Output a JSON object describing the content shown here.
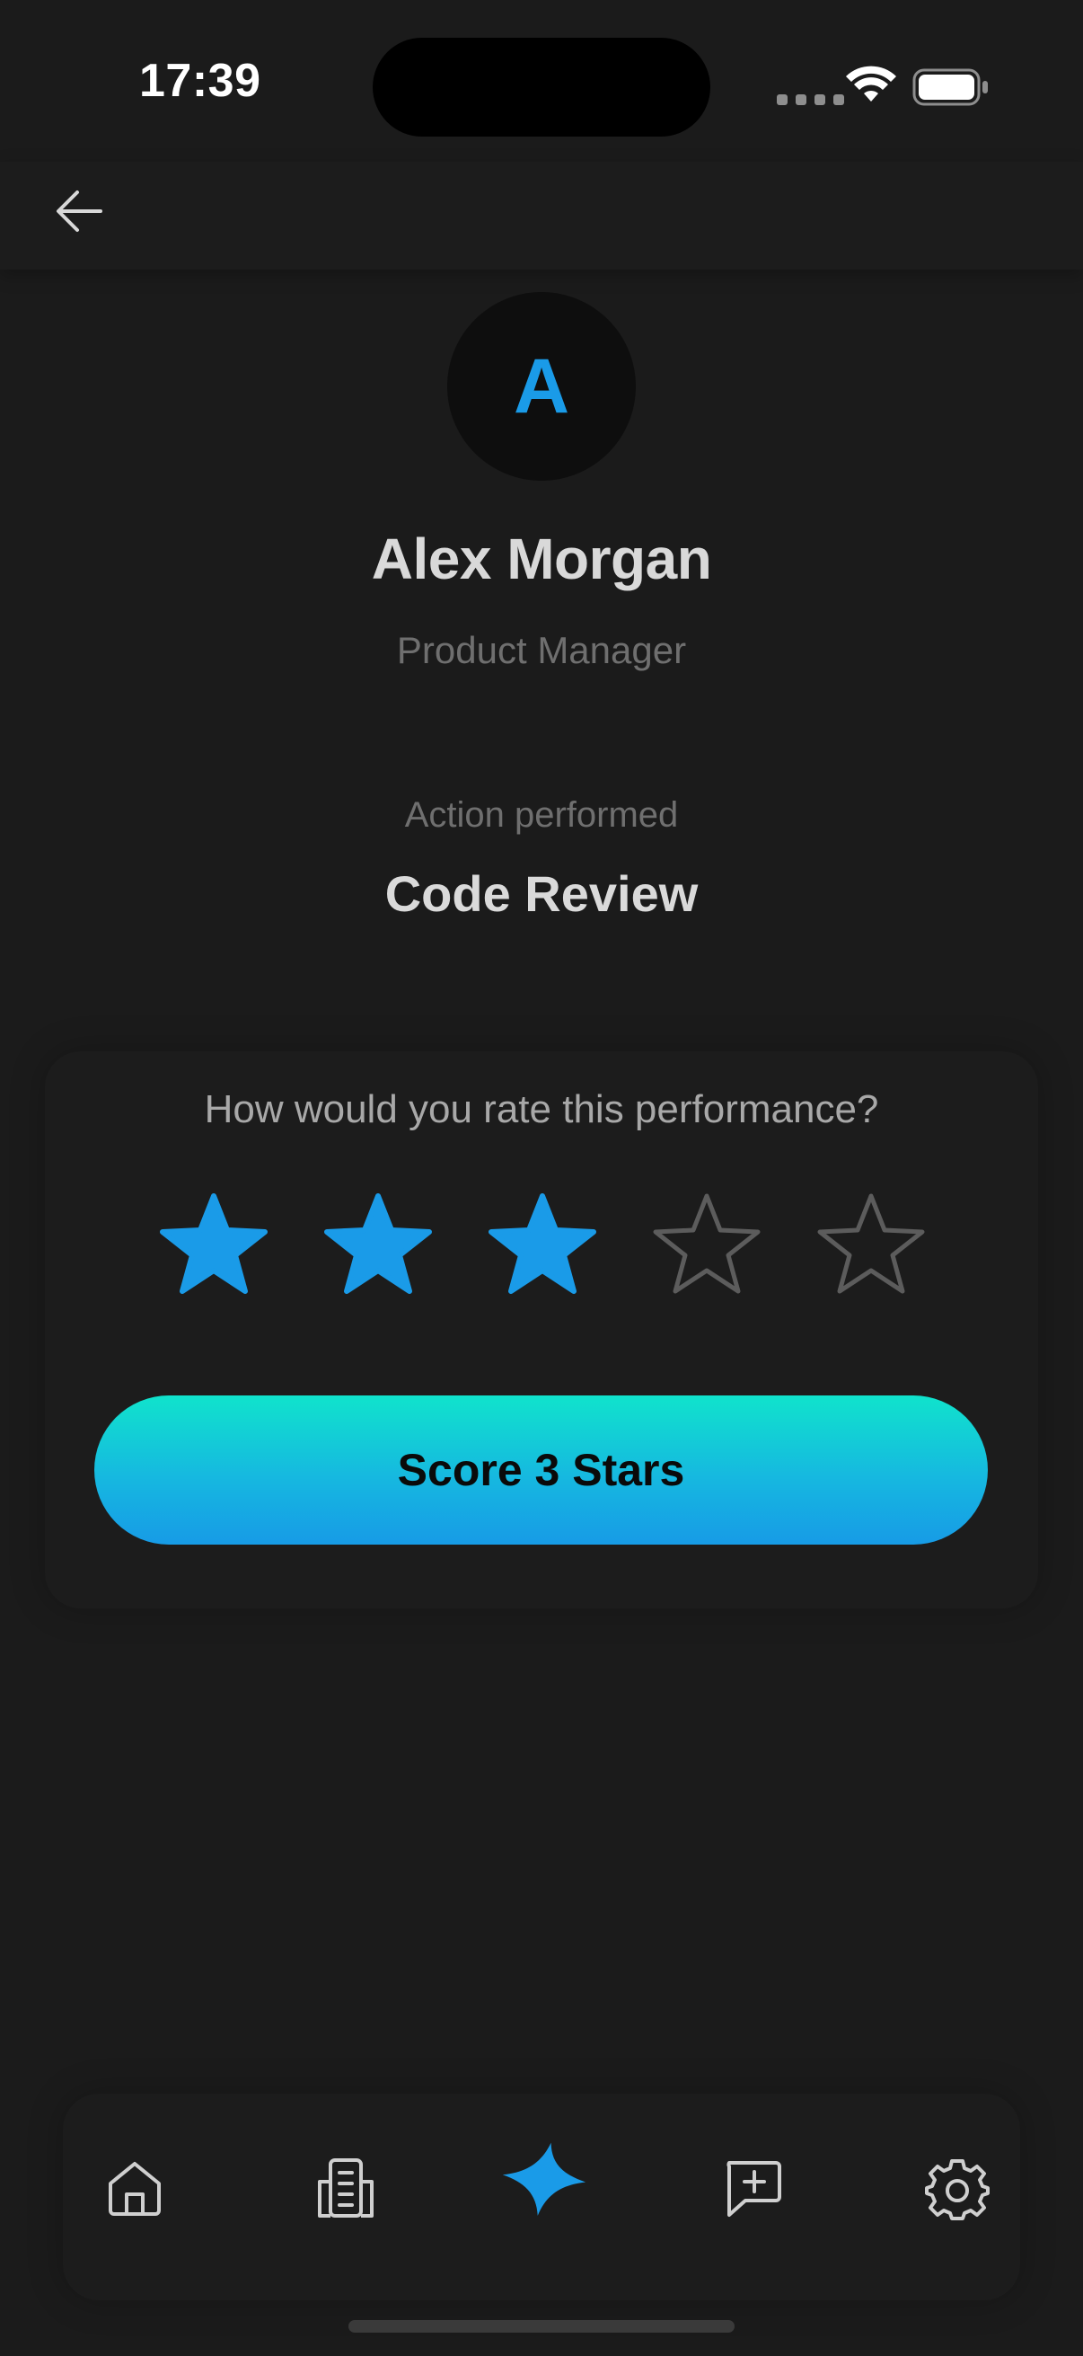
{
  "status_bar": {
    "time": "17:39"
  },
  "header": {
    "back_icon": "arrow-left-icon"
  },
  "profile": {
    "initial": "A",
    "name": "Alex Morgan",
    "role": "Product Manager"
  },
  "action": {
    "caption": "Action performed",
    "value": "Code Review"
  },
  "rating": {
    "question": "How would you rate this performance?",
    "max_stars": 5,
    "selected_stars": 3,
    "button_label": "Score 3 Stars"
  },
  "nav": {
    "items": [
      {
        "icon": "home-icon",
        "active": false
      },
      {
        "icon": "building-icon",
        "active": false
      },
      {
        "icon": "sparkle-icon",
        "active": true
      },
      {
        "icon": "message-plus-icon",
        "active": false
      },
      {
        "icon": "gear-icon",
        "active": false
      }
    ]
  },
  "colors": {
    "background": "#1b1b1b",
    "accent": "#1a9be8",
    "gradient_top": "#10e3cc",
    "gradient_bottom": "#179be6",
    "star_empty": "#5c5c5c"
  }
}
